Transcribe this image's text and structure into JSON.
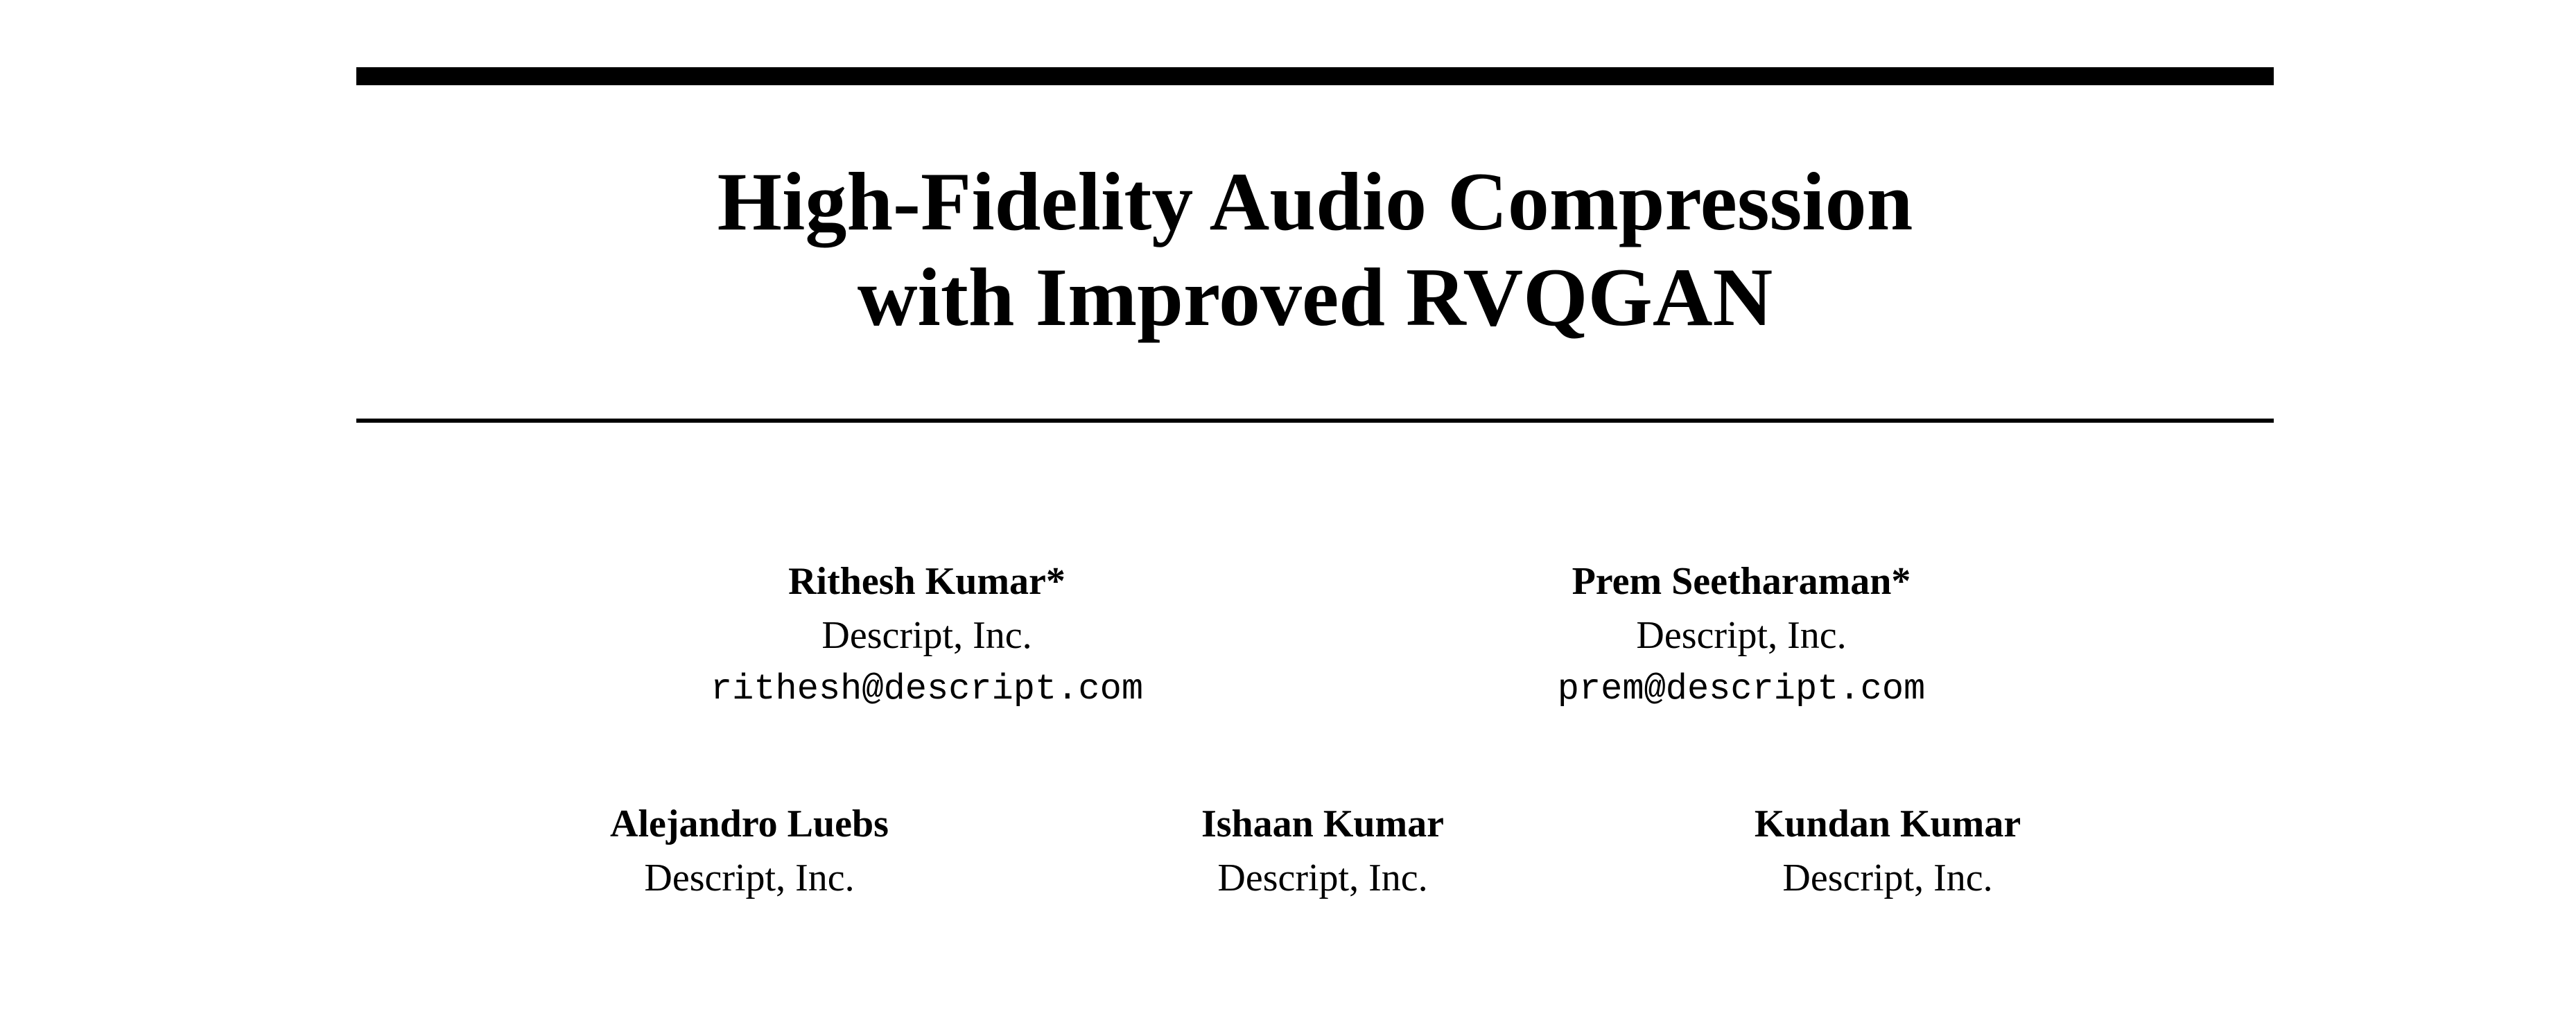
{
  "title": {
    "line1": "High-Fidelity Audio Compression",
    "line2": "with Improved RVQGAN"
  },
  "authors": [
    {
      "name": "Rithesh Kumar*",
      "affiliation": "Descript, Inc.",
      "email": "rithesh@descript.com"
    },
    {
      "name": "Prem Seetharaman*",
      "affiliation": "Descript, Inc.",
      "email": "prem@descript.com"
    },
    {
      "name": "Alejandro Luebs",
      "affiliation": "Descript, Inc."
    },
    {
      "name": "Ishaan Kumar",
      "affiliation": "Descript, Inc."
    },
    {
      "name": "Kundan Kumar",
      "affiliation": "Descript, Inc."
    }
  ]
}
